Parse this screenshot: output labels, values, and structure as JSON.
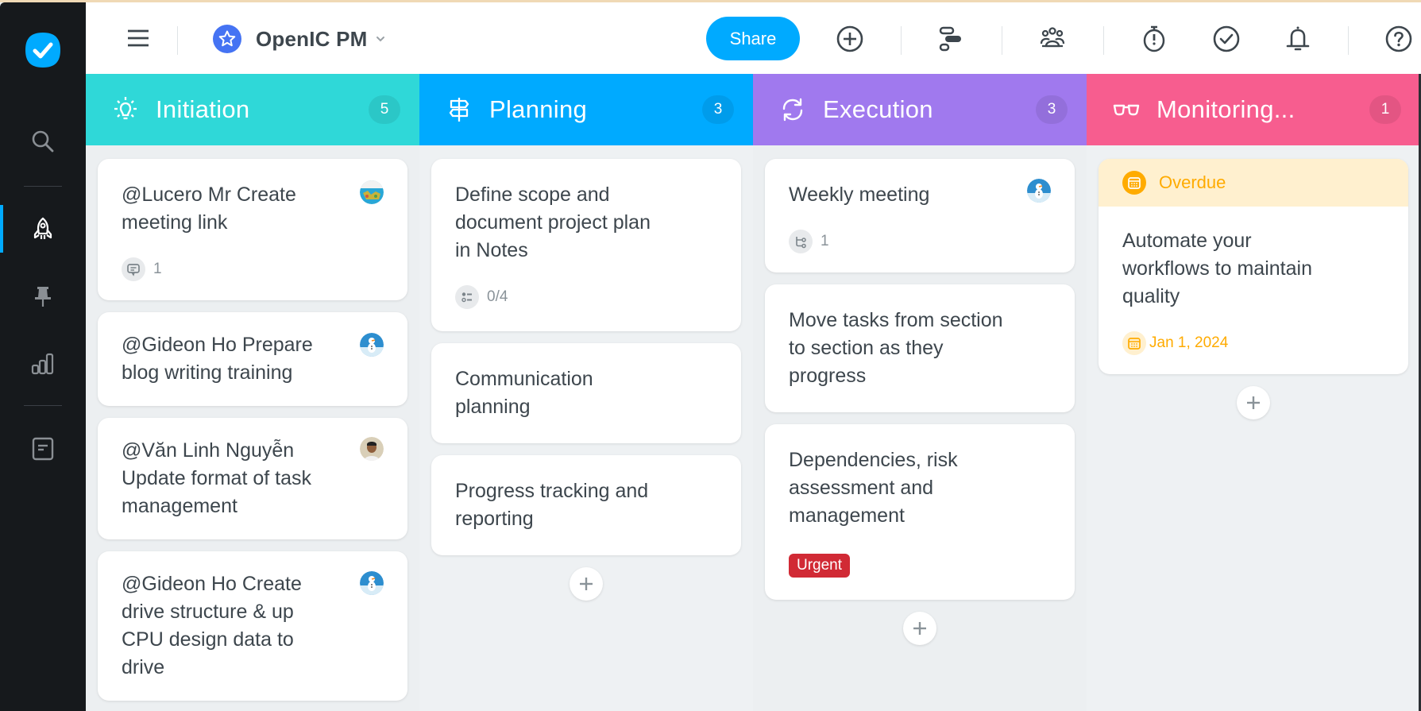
{
  "header": {
    "project_name": "OpenIC PM",
    "share_label": "Share",
    "icons": [
      "menu-icon",
      "star-icon",
      "chevron-down-icon",
      "add-icon",
      "timeline-icon",
      "team-icon",
      "timer-icon",
      "check-circle-icon",
      "bell-icon",
      "help-icon"
    ]
  },
  "sidebar": {
    "items": [
      {
        "name": "search",
        "icon": "search-icon",
        "active": false
      },
      {
        "name": "projects",
        "icon": "rocket-icon",
        "active": true
      },
      {
        "name": "pinned",
        "icon": "pin-icon",
        "active": false
      },
      {
        "name": "reports",
        "icon": "bar-chart-icon",
        "active": false
      },
      {
        "name": "notes",
        "icon": "note-icon",
        "active": false
      }
    ]
  },
  "colors": {
    "accent": "#00aaff",
    "initiation": "#2fd8d8",
    "planning": "#00aaff",
    "execution": "#a079ee",
    "monitoring": "#f75d8f",
    "overdue": "#ffab00",
    "urgent": "#d12a35"
  },
  "columns": [
    {
      "title": "Initiation",
      "count": "5",
      "icon": "lightbulb-icon",
      "cards": [
        {
          "title": "@Lucero Mr Create meeting link",
          "avatar": "map",
          "meta_icon": "comment-icon",
          "meta": "1"
        },
        {
          "title": "@Gideon Ho Prepare blog writing training",
          "avatar": "snowman"
        },
        {
          "title": "@Văn Linh Nguyễn Update format of task management",
          "avatar": "person"
        },
        {
          "title": "@Gideon Ho Create drive structure & up CPU design data to drive",
          "avatar": "snowman"
        }
      ]
    },
    {
      "title": "Planning",
      "count": "3",
      "icon": "signpost-icon",
      "cards": [
        {
          "title": "Define scope and document project plan in Notes",
          "meta_icon": "checklist-icon",
          "meta": "0/4"
        },
        {
          "title": "Communication planning"
        },
        {
          "title": "Progress tracking and reporting"
        }
      ]
    },
    {
      "title": "Execution",
      "count": "3",
      "icon": "refresh-icon",
      "cards": [
        {
          "title": "Weekly meeting",
          "avatar": "snowman",
          "meta_icon": "subtask-icon",
          "meta": "1"
        },
        {
          "title": "Move tasks from section to section as they progress"
        },
        {
          "title": "Dependencies, risk assessment and management",
          "badge": "Urgent"
        }
      ]
    },
    {
      "title": "Monitoring...",
      "count": "1",
      "icon": "glasses-icon",
      "cards": [
        {
          "status": "Overdue",
          "title": "Automate your workflows to maintain quality",
          "due": "Jan 1, 2024"
        }
      ]
    }
  ]
}
